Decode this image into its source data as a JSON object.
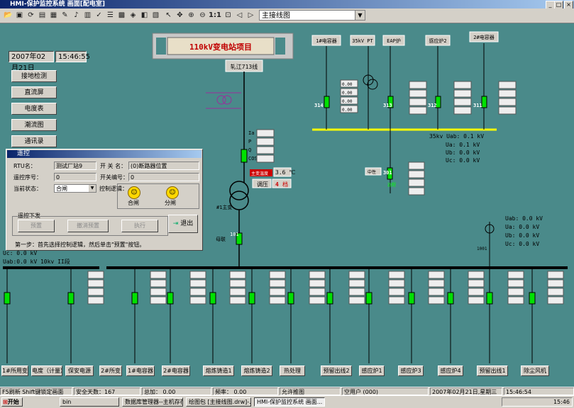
{
  "window": {
    "title": "HMI-保护监控系统 画面[配电室]",
    "controls": [
      "_",
      "□",
      "×"
    ]
  },
  "toolbar": {
    "zoom_label": "1:1",
    "combo_value": "主接线图"
  },
  "datetime": {
    "date": "2007年02月21日",
    "time": "15:46:55"
  },
  "banner": {
    "title": "110kV变电站项目"
  },
  "nav_buttons": [
    "接地检测",
    "直流屏",
    "电度表",
    "潮流图",
    "通讯录"
  ],
  "diagram": {
    "line_label": "轧江713线",
    "top_buttons": [
      "1#电容器",
      "35kV PT",
      "EAP炉",
      "感应炉2",
      "2#电容器"
    ],
    "top_section_voltage": [
      "35kv Uab: 0.1 kV",
      "Ua: 0.1 kV",
      "Ub: 0.0 kV",
      "Uc: 0.0 kV"
    ],
    "bottom_section_voltage": [
      "Uab: 0.0 kV",
      "Ua: 0.0 kV",
      "Ub: 0.0 kV",
      "Uc: 0.0 kV"
    ],
    "left_voltage": [
      "Uc: 0.0 kV",
      "Uab:0.0 kV 10kv II段"
    ],
    "transformer": {
      "label": "主变温度",
      "temp": "3.6 ℃",
      "tap_label": "调压",
      "tap_value": "4",
      "tap_unit": "档"
    },
    "meas_labels": [
      "Ia",
      "P",
      "Q",
      "COS"
    ],
    "meas_value": "0.00",
    "feeder_ids": [
      "314",
      "313",
      "312",
      "311",
      "301",
      "101"
    ],
    "status_remote": "远程",
    "pt_label": "1001",
    "middle_label": "中性",
    "trans_label": "#1主变",
    "ct_label": "母联"
  },
  "bottom_buttons": [
    "1#所用变",
    "电度（计量）",
    "保安电源",
    "2#所变",
    "1#电容器",
    "2#电容器",
    "熔炼铸造1",
    "熔炼铸造2",
    "热处理",
    "预留出线2",
    "感应炉1",
    "感应炉3",
    "感应炉4",
    "预留出线1",
    "除尘风机"
  ],
  "dialog": {
    "title": "遥控",
    "rtu_label": "RTU名：",
    "rtu_value": "测试厂站9",
    "switch_name_label": "开 关 名：",
    "switch_name_value": "(0)断路器位置",
    "remote_no_label": "遥控序号：",
    "remote_no_value": "0",
    "switch_no_label": "开关编号：",
    "switch_no_value": "0",
    "state_label": "当前状态：",
    "state_value": "合闸",
    "logic_label": "控制逻辑：",
    "close_label": "合闸",
    "open_label": "分闸",
    "group_label": "遥控下发",
    "btn_preset": "预置",
    "btn_cancel": "撤消预置",
    "btn_exec": "执行",
    "btn_exit": "退出",
    "hint": "第一步：首先选择控制逻辑，然后单击\"预置\"按钮。"
  },
  "statusbar": {
    "refresh": "F5刷新 Shift键锁定画面",
    "safe_days": "安全天数：167",
    "total_label": "总加：",
    "total_value": "0.00",
    "freq_label": "频率：",
    "freq_value": "0.00",
    "allow": "允许推图",
    "user": "空用户 (000)",
    "date": "2007年02月21日,星期三",
    "time": "15:46:54"
  },
  "taskbar": {
    "start": "开始",
    "tasks": [
      "bin",
      "数据库管理器--主机存在!",
      "绘图包 [主接线图.drw]-...",
      "HMI-保护监控系统 画面..."
    ],
    "tray_time": "15:46"
  }
}
